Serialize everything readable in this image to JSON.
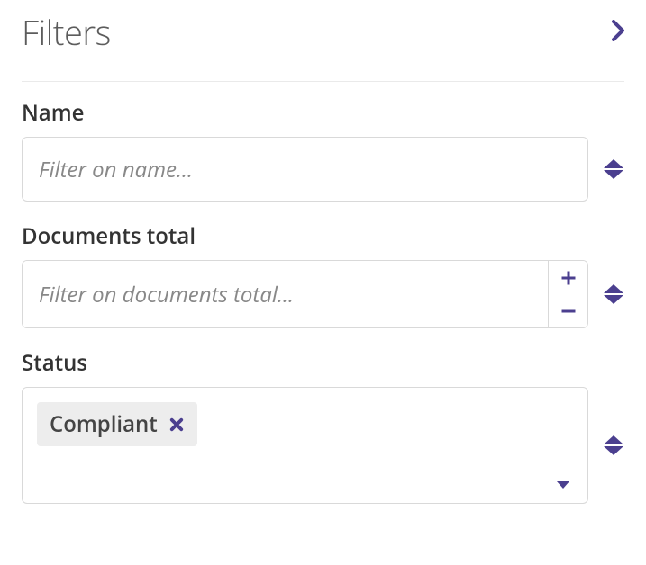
{
  "header": {
    "title": "Filters"
  },
  "filters": {
    "name": {
      "label": "Name",
      "placeholder": "Filter on name...",
      "value": ""
    },
    "documentsTotal": {
      "label": "Documents total",
      "placeholder": "Filter on documents total...",
      "value": ""
    },
    "status": {
      "label": "Status",
      "selected": [
        {
          "label": "Compliant"
        }
      ]
    }
  },
  "colors": {
    "accent": "#4b3f8f"
  }
}
